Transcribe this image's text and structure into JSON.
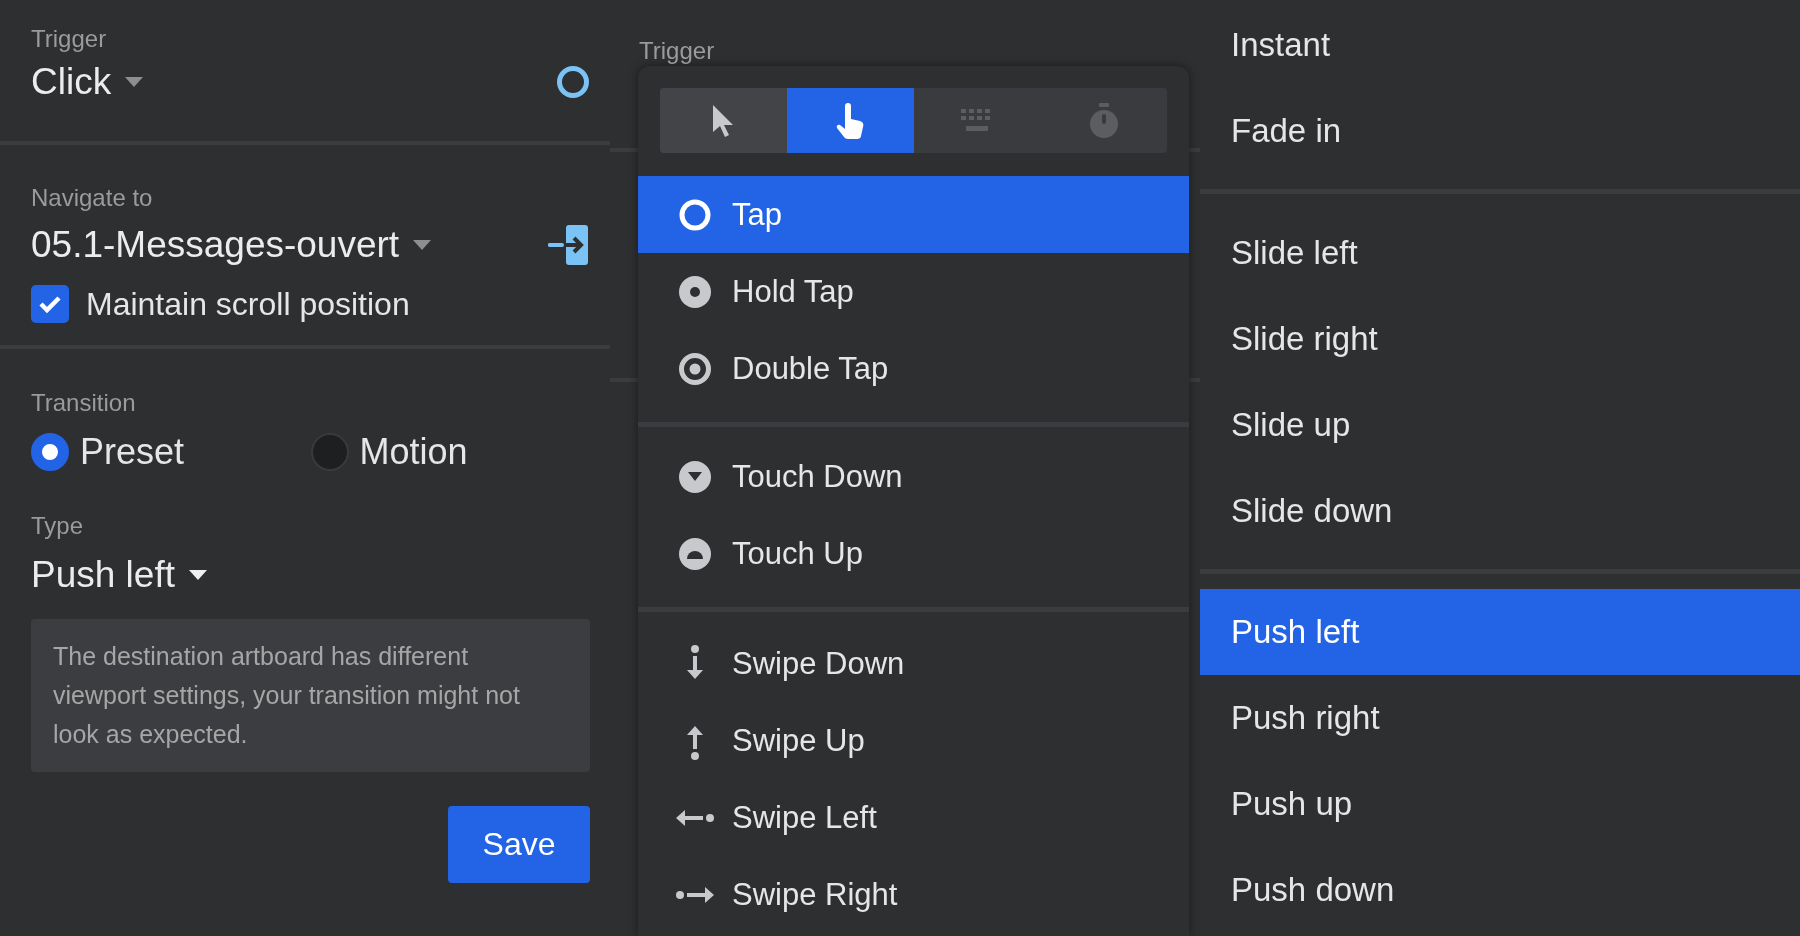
{
  "settings_panel": {
    "trigger": {
      "label": "Trigger",
      "value": "Click"
    },
    "navigate": {
      "label": "Navigate to",
      "value": "05.1-Messages-ouvert"
    },
    "maintain_scroll": {
      "label": "Maintain scroll position",
      "checked": true
    },
    "transition": {
      "label": "Transition",
      "options": [
        {
          "label": "Preset",
          "selected": true
        },
        {
          "label": "Motion",
          "selected": false
        }
      ]
    },
    "type": {
      "label": "Type",
      "value": "Push left"
    },
    "note": "The destination artboard has different viewport settings, your transition might not look as expected.",
    "save_button": "Save"
  },
  "trigger_menu": {
    "label": "Trigger",
    "tabs": [
      {
        "selected": false
      },
      {
        "selected": true
      },
      {
        "selected": false
      },
      {
        "selected": false
      }
    ],
    "groups": [
      {
        "items": [
          {
            "label": "Tap",
            "selected": true
          },
          {
            "label": "Hold Tap",
            "selected": false
          },
          {
            "label": "Double Tap",
            "selected": false
          }
        ]
      },
      {
        "items": [
          {
            "label": "Touch Down",
            "selected": false
          },
          {
            "label": "Touch Up",
            "selected": false
          }
        ]
      },
      {
        "items": [
          {
            "label": "Swipe Down",
            "selected": false
          },
          {
            "label": "Swipe Up",
            "selected": false
          },
          {
            "label": "Swipe Left",
            "selected": false
          },
          {
            "label": "Swipe Right",
            "selected": false
          }
        ]
      }
    ]
  },
  "transition_menu": {
    "groups": [
      {
        "items": [
          {
            "label": "Instant",
            "selected": false
          },
          {
            "label": "Fade in",
            "selected": false
          }
        ]
      },
      {
        "items": [
          {
            "label": "Slide left",
            "selected": false
          },
          {
            "label": "Slide right",
            "selected": false
          },
          {
            "label": "Slide up",
            "selected": false
          },
          {
            "label": "Slide down",
            "selected": false
          }
        ]
      },
      {
        "items": [
          {
            "label": "Push left",
            "selected": true
          },
          {
            "label": "Push right",
            "selected": false
          },
          {
            "label": "Push up",
            "selected": false
          },
          {
            "label": "Push down",
            "selected": false
          }
        ]
      }
    ]
  }
}
